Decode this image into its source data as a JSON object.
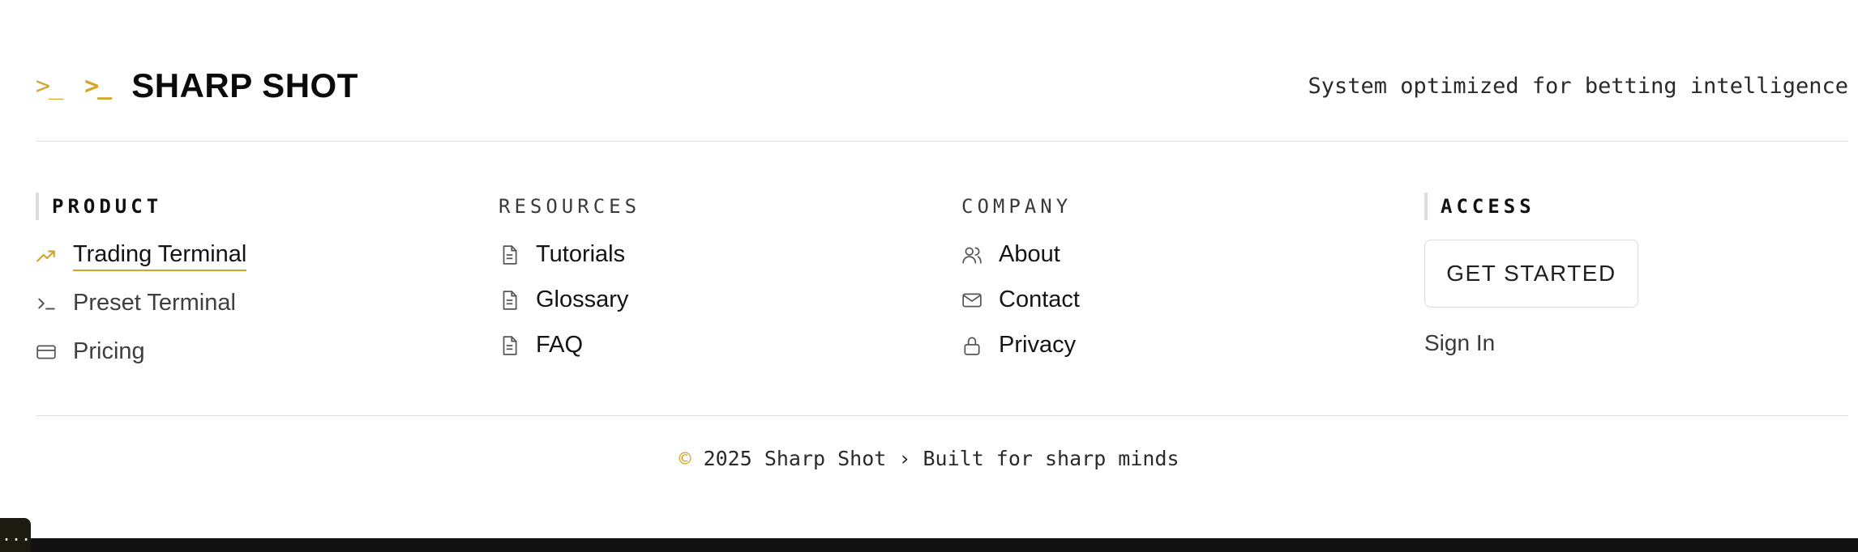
{
  "header": {
    "logo_glyph_1": ">_",
    "logo_glyph_2": ">_",
    "brand": "SHARP SHOT",
    "tagline": "System optimized for betting intelligence"
  },
  "product": {
    "heading": "PRODUCT",
    "items": [
      {
        "label": "Trading Terminal",
        "icon": "trending-up-icon",
        "active": true
      },
      {
        "label": "Preset Terminal",
        "icon": "terminal-icon"
      },
      {
        "label": "Pricing",
        "icon": "credit-card-icon"
      }
    ]
  },
  "resources": {
    "heading": "RESOURCES",
    "items": [
      {
        "label": "Tutorials",
        "icon": "document-icon"
      },
      {
        "label": "Glossary",
        "icon": "document-icon"
      },
      {
        "label": "FAQ",
        "icon": "document-icon"
      }
    ]
  },
  "company": {
    "heading": "COMPANY",
    "items": [
      {
        "label": "About",
        "icon": "users-icon"
      },
      {
        "label": "Contact",
        "icon": "mail-icon"
      },
      {
        "label": "Privacy",
        "icon": "lock-icon"
      }
    ]
  },
  "access": {
    "heading": "ACCESS",
    "get_started": "GET STARTED",
    "sign_in": "Sign In"
  },
  "footer": {
    "copyright_symbol": "©",
    "text": "2025 Sharp Shot › Built for sharp minds"
  },
  "badge": {
    "label": "..."
  },
  "colors": {
    "accent": "#d4a52a",
    "divider": "#dedede",
    "bottom_bar": "#121212"
  }
}
